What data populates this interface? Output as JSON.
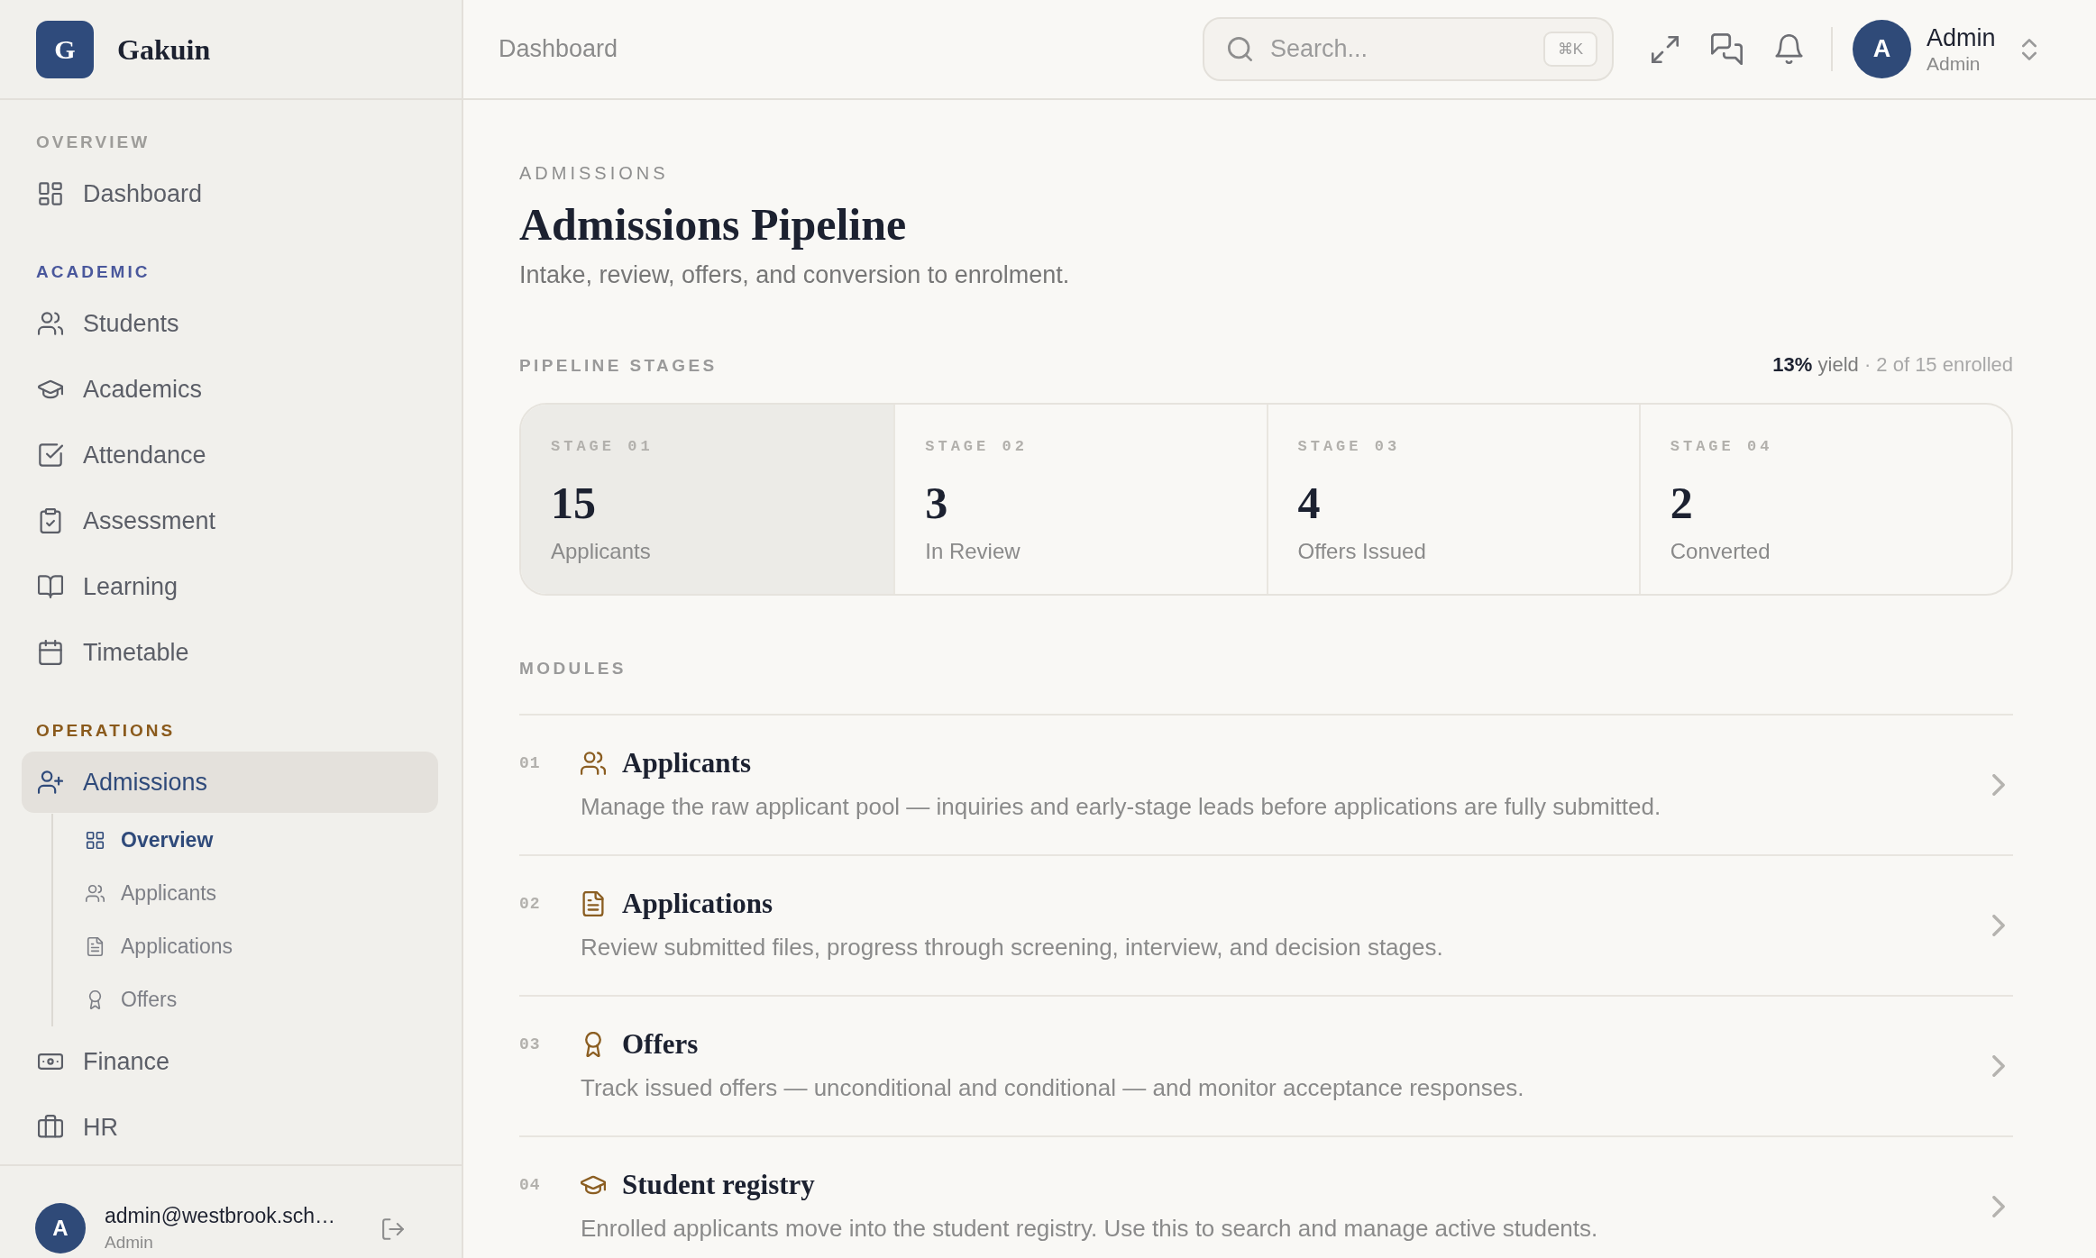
{
  "sidebar": {
    "brand": {
      "logo": "G",
      "name": "Gakuin"
    },
    "sections": [
      {
        "label": "OVERVIEW",
        "color": "#9d9c99",
        "items": [
          {
            "label": "Dashboard",
            "selected": false
          }
        ]
      },
      {
        "label": "ACADEMIC",
        "color": "#4a589c",
        "items": [
          {
            "label": "Students",
            "selected": false
          },
          {
            "label": "Academics",
            "selected": false
          },
          {
            "label": "Attendance",
            "selected": false
          },
          {
            "label": "Assessment",
            "selected": false
          },
          {
            "label": "Learning",
            "selected": false
          },
          {
            "label": "Timetable",
            "selected": false
          }
        ]
      },
      {
        "label": "OPERATIONS",
        "color": "#8a5a1c",
        "items": [
          {
            "label": "Admissions",
            "selected": true,
            "expanded": true,
            "children": [
              {
                "label": "Overview",
                "selected": true
              },
              {
                "label": "Applicants",
                "selected": false
              },
              {
                "label": "Applications",
                "selected": false
              },
              {
                "label": "Offers",
                "selected": false
              }
            ]
          },
          {
            "label": "Finance",
            "selected": false
          },
          {
            "label": "HR",
            "selected": false
          }
        ]
      }
    ],
    "account": {
      "avatar": "A",
      "email": "admin@westbrook.sch…",
      "role": "Admin"
    }
  },
  "top_bar": {
    "breadcrumb": "Dashboard",
    "search": {
      "placeholder": "Search...",
      "shortcut": "⌘K"
    },
    "user": {
      "avatar": "A",
      "name": "Admin",
      "role": "Admin"
    }
  },
  "page": {
    "eyebrow": "ADMISSIONS",
    "title": "Admissions Pipeline",
    "subtitle": "Intake, review, offers, and conversion to enrolment.",
    "pipeline": {
      "label": "PIPELINE STAGES",
      "yield": "**13%** yield",
      "summary": "· 2 of 15 enrolled",
      "stages": [
        {
          "label": "STAGE 01",
          "count": "15",
          "name": "Applicants",
          "selected": true
        },
        {
          "label": "STAGE 02",
          "count": "3",
          "name": "In Review",
          "selected": false
        },
        {
          "label": "STAGE 03",
          "count": "4",
          "name": "Offers Issued",
          "selected": false
        },
        {
          "label": "STAGE 04",
          "count": "2",
          "name": "Converted",
          "selected": false
        }
      ]
    },
    "modules": {
      "label": "MODULES",
      "items": [
        {
          "number": "01",
          "title": "Applicants",
          "description": "Manage the raw applicant pool — inquiries and early-stage leads before applications are fully submitted."
        },
        {
          "number": "02",
          "title": "Applications",
          "description": "Review submitted files, progress through screening, interview, and decision stages."
        },
        {
          "number": "03",
          "title": "Offers",
          "description": "Track issued offers — unconditional and conditional — and monitor acceptance responses."
        },
        {
          "number": "04",
          "title": "Student registry",
          "description": "Enrolled applicants move into the student registry. Use this to search and manage active students."
        }
      ]
    }
  }
}
